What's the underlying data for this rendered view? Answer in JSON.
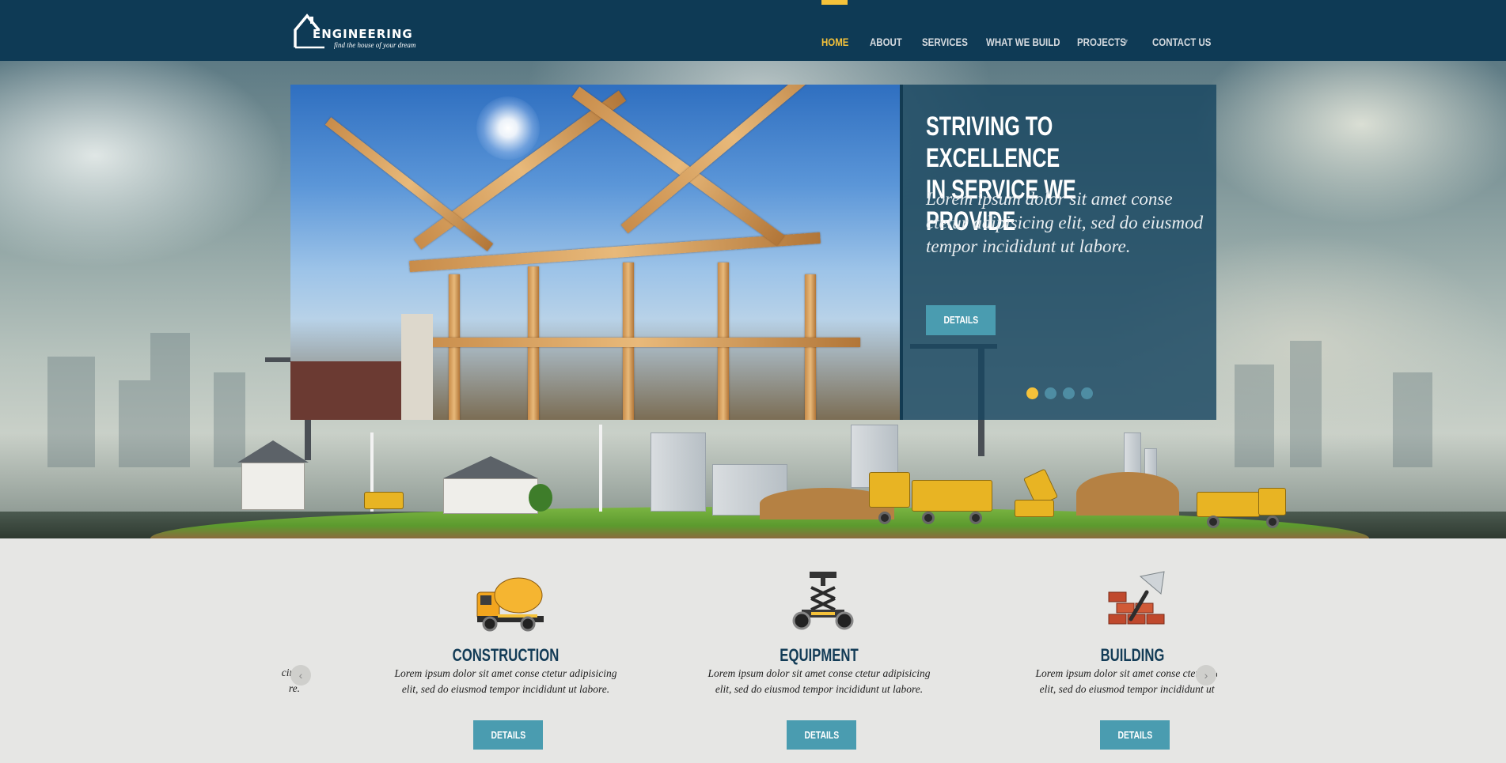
{
  "brand": {
    "name": "ENGINEERING",
    "tagline": "find the house of your dream",
    "logo_icon": "house-outline-icon"
  },
  "nav": {
    "items": [
      {
        "label": "HOME",
        "active": true
      },
      {
        "label": "ABOUT"
      },
      {
        "label": "SERVICES"
      },
      {
        "label": "WHAT WE BUILD"
      },
      {
        "label": "PROJECTS",
        "has_dropdown": true
      },
      {
        "label": "CONTACT US"
      }
    ],
    "dropdown_icon": "chevron-down-icon"
  },
  "slider": {
    "title": "STRIVING TO EXCELLENCE\nIN SERVICE WE PROVIDE",
    "text": "Lorem ipsum dolor sit amet conse ctetur adipisicing elit, sed do eiusmod tempor incididunt ut labore.",
    "button": "DETAILS",
    "slide_count": 4,
    "active_slide": 1
  },
  "features": [
    {
      "icon": "concrete-mixer-truck-icon",
      "title": "CONSTRUCTION",
      "text_line1": "Lorem ipsum dolor sit amet conse ctetur adipisicing",
      "text_line2": "elit, sed do eiusmod tempor incididunt ut labore.",
      "button": "DETAILS"
    },
    {
      "icon": "scissor-lift-icon",
      "title": "EQUIPMENT",
      "text_line1": "Lorem ipsum dolor sit amet conse ctetur adipisicing",
      "text_line2": "elit, sed do eiusmod tempor incididunt ut labore.",
      "button": "DETAILS"
    },
    {
      "icon": "bricks-trowel-icon",
      "title": "BUILDING",
      "text_line1": "Lorem ipsum dolor sit amet conse ctetur adip",
      "text_line2": "elit, sed do eiusmod tempor incididunt ut la",
      "button": "DETAILS"
    }
  ],
  "clipped_prev": {
    "line1": "cing",
    "line2": "re."
  },
  "colors": {
    "header_bg": "#0e3a55",
    "accent_yellow": "#f5c23a",
    "button_teal": "#4a9cb0",
    "panel_bg": "#174560",
    "feature_title": "#123b56"
  }
}
